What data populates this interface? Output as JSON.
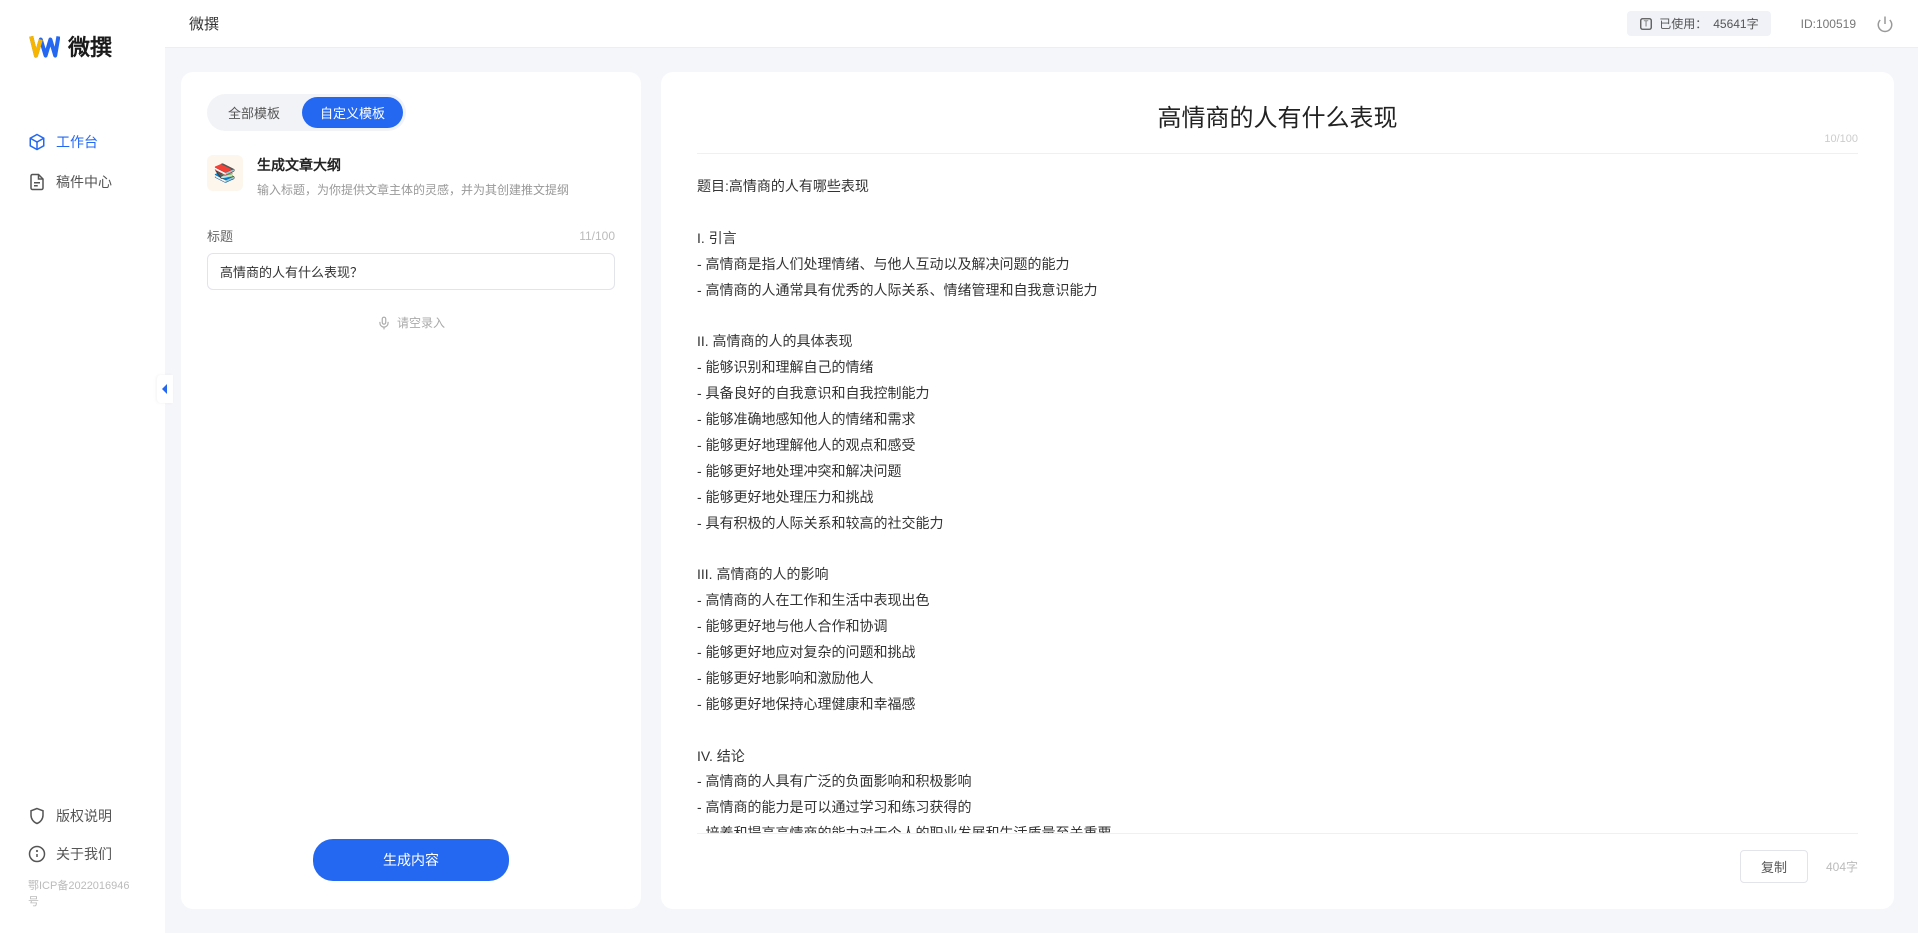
{
  "header": {
    "app_name": "微撰",
    "usage_label": "已使用：",
    "usage_value": "45641字",
    "user_id_label": "ID:",
    "user_id": "100519"
  },
  "logo_text": "微撰",
  "nav": {
    "workbench": "工作台",
    "drafts": "稿件中心"
  },
  "footer_nav": {
    "copyright": "版权说明",
    "about": "关于我们",
    "icp": "鄂ICP备2022016946号"
  },
  "left_panel": {
    "tabs": {
      "all": "全部模板",
      "custom": "自定义模板"
    },
    "template": {
      "title": "生成文章大纲",
      "desc": "输入标题，为你提供文章主体的灵感，并为其创建推文提纲"
    },
    "field_label": "标题",
    "char_counter": "11/100",
    "title_value": "高情商的人有什么表现？",
    "voice_hint": "请空录入",
    "generate_btn": "生成内容"
  },
  "right_panel": {
    "title": "高情商的人有什么表现",
    "title_counter": "10/100",
    "body": "题目:高情商的人有哪些表现\n\nI. 引言\n- 高情商是指人们处理情绪、与他人互动以及解决问题的能力\n- 高情商的人通常具有优秀的人际关系、情绪管理和自我意识能力\n\nII. 高情商的人的具体表现\n- 能够识别和理解自己的情绪\n- 具备良好的自我意识和自我控制能力\n- 能够准确地感知他人的情绪和需求\n- 能够更好地理解他人的观点和感受\n- 能够更好地处理冲突和解决问题\n- 能够更好地处理压力和挑战\n- 具有积极的人际关系和较高的社交能力\n\nIII. 高情商的人的影响\n- 高情商的人在工作和生活中表现出色\n- 能够更好地与他人合作和协调\n- 能够更好地应对复杂的问题和挑战\n- 能够更好地影响和激励他人\n- 能够更好地保持心理健康和幸福感\n\nIV. 结论\n- 高情商的人具有广泛的负面影响和积极影响\n- 高情商的能力是可以通过学习和练习获得的\n- 培养和提高高情商的能力对于个人的职业发展和生活质量至关重要。",
    "copy_btn": "复制",
    "word_count": "404字"
  }
}
